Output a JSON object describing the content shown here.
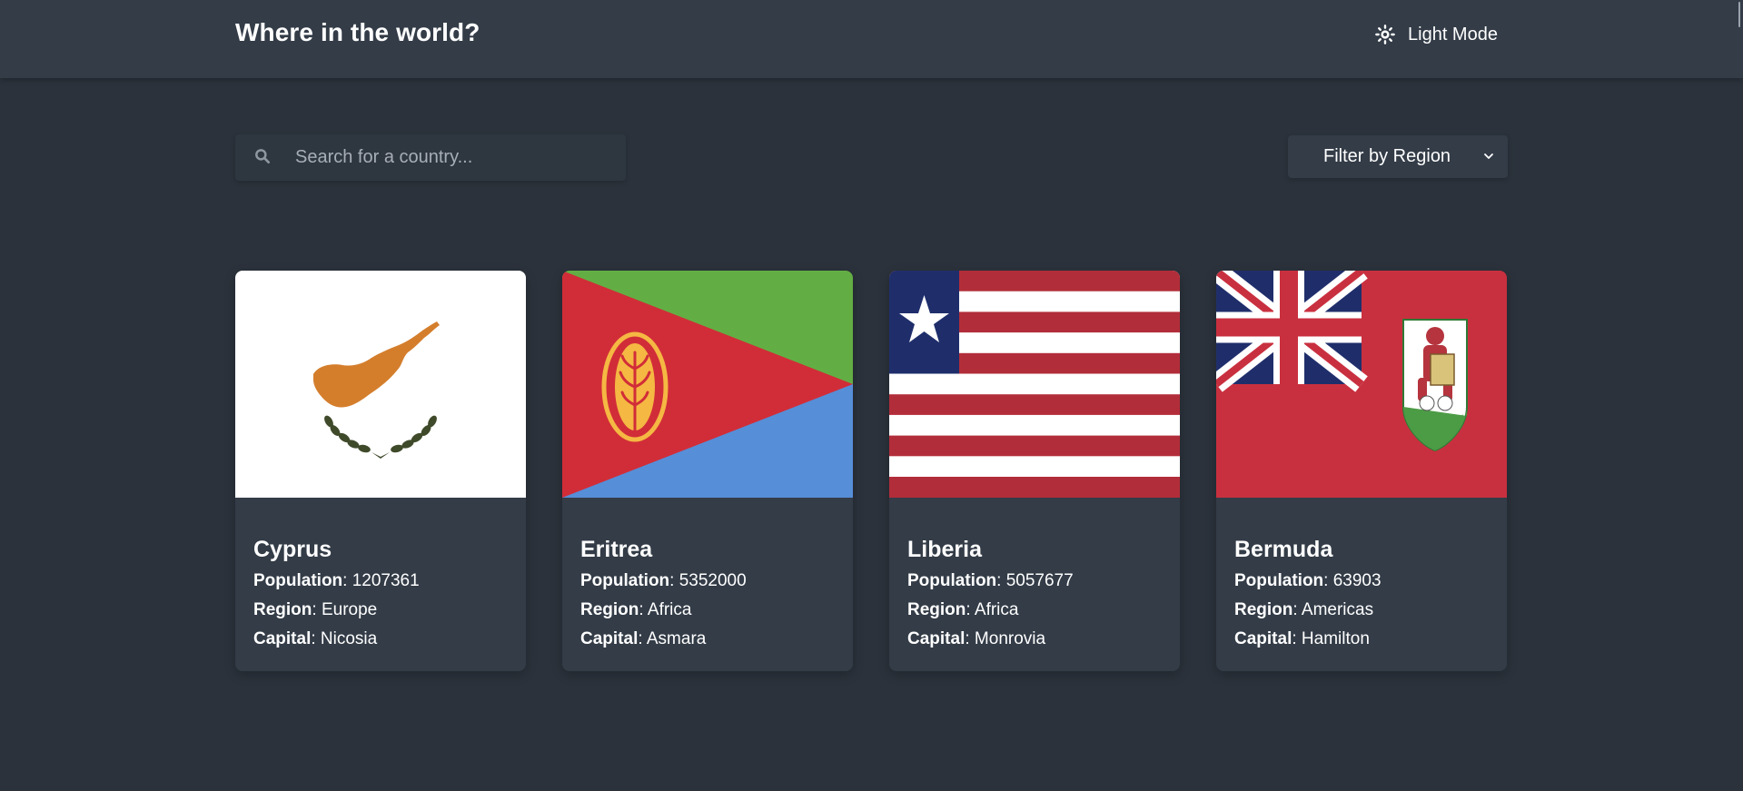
{
  "header": {
    "title": "Where in the world?",
    "mode_label": "Light Mode",
    "mode_icon": "sun-icon"
  },
  "search": {
    "placeholder": "Search for a country...",
    "value": "",
    "icon": "search-icon"
  },
  "filter": {
    "label": "Filter by Region",
    "icon": "chevron-down-icon"
  },
  "labels": {
    "population": "Population",
    "region": "Region",
    "capital": "Capital",
    "separator": ":"
  },
  "countries": [
    {
      "name": "Cyprus",
      "population": "1207361",
      "region": "Europe",
      "capital": "Nicosia",
      "flag": "cyprus-flag"
    },
    {
      "name": "Eritrea",
      "population": "5352000",
      "region": "Africa",
      "capital": "Asmara",
      "flag": "eritrea-flag"
    },
    {
      "name": "Liberia",
      "population": "5057677",
      "region": "Africa",
      "capital": "Monrovia",
      "flag": "liberia-flag"
    },
    {
      "name": "Bermuda",
      "population": "63903",
      "region": "Americas",
      "capital": "Hamilton",
      "flag": "bermuda-flag"
    }
  ],
  "colors": {
    "background": "#2b323b",
    "surface": "#333c47",
    "text": "#ffffff",
    "placeholder": "#a7aeb6"
  }
}
